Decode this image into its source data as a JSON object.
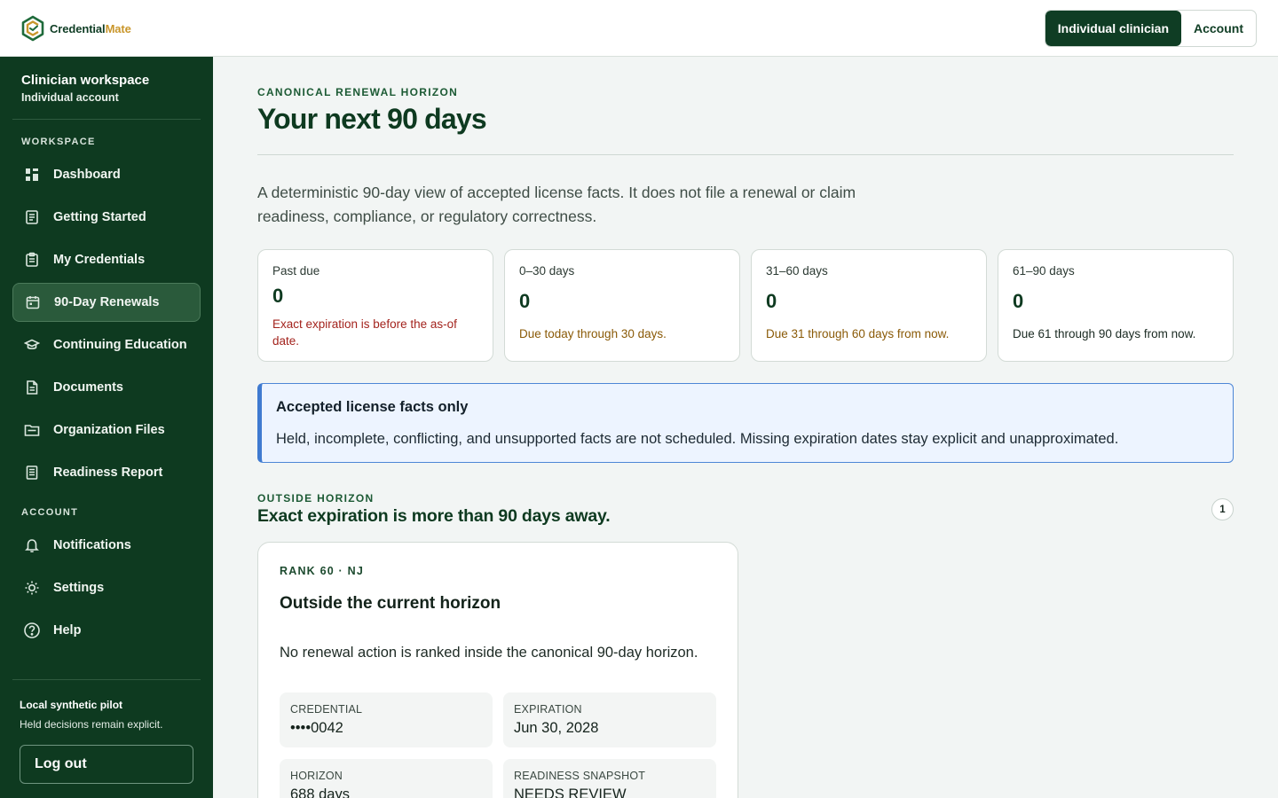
{
  "brand": {
    "name_main": "Credential",
    "name_accent": "Mate"
  },
  "topbar": {
    "individual_label": "Individual clinician",
    "account_label": "Account"
  },
  "sidebar": {
    "workspace_title": "Clinician workspace",
    "workspace_sub": "Individual account",
    "workspace_section": "WORKSPACE",
    "account_section": "ACCOUNT",
    "items": [
      {
        "label": "Dashboard",
        "icon": "dashboard-icon"
      },
      {
        "label": "Getting Started",
        "icon": "checklist-icon"
      },
      {
        "label": "My Credentials",
        "icon": "clipboard-icon"
      },
      {
        "label": "90-Day Renewals",
        "icon": "calendar-icon",
        "active": true
      },
      {
        "label": "Continuing Education",
        "icon": "graduation-cap-icon"
      },
      {
        "label": "Documents",
        "icon": "document-icon"
      },
      {
        "label": "Organization Files",
        "icon": "folder-icon"
      },
      {
        "label": "Readiness Report",
        "icon": "report-icon"
      }
    ],
    "account_items": [
      {
        "label": "Notifications",
        "icon": "bell-icon"
      },
      {
        "label": "Settings",
        "icon": "gear-icon"
      },
      {
        "label": "Help",
        "icon": "help-icon"
      }
    ],
    "pilot_title": "Local synthetic pilot",
    "pilot_sub": "Held decisions remain explicit.",
    "logout_label": "Log out"
  },
  "main": {
    "eyebrow": "CANONICAL RENEWAL HORIZON",
    "title": "Your next 90 days",
    "intro": "A deterministic 90-day view of accepted license facts. It does not file a renewal or claim readiness, compliance, or regulatory correctness.",
    "stats": [
      {
        "label": "Past due",
        "value": "0",
        "note": "Exact expiration is before the as-of date.",
        "tone": "red"
      },
      {
        "label": "0–30 days",
        "value": "0",
        "note": "Due today through 30 days.",
        "tone": "amber"
      },
      {
        "label": "31–60 days",
        "value": "0",
        "note": "Due 31 through 60 days from now.",
        "tone": "amber"
      },
      {
        "label": "61–90 days",
        "value": "0",
        "note": "Due 61 through 90 days from now.",
        "tone": "dark"
      }
    ],
    "callout": {
      "title": "Accepted license facts only",
      "body": "Held, incomplete, conflicting, and unsupported facts are not scheduled. Missing expiration dates stay explicit and unapproximated."
    },
    "outside": {
      "eyebrow": "OUTSIDE HORIZON",
      "title": "Exact expiration is more than 90 days away.",
      "count": "1",
      "card": {
        "eyebrow": "RANK 60 · NJ",
        "title": "Outside the current horizon",
        "body": "No renewal action is ranked inside the canonical 90-day horizon.",
        "facts": [
          {
            "label": "CREDENTIAL",
            "value": "••••0042"
          },
          {
            "label": "EXPIRATION",
            "value": "Jun 30, 2028"
          },
          {
            "label": "HORIZON",
            "value": "688 days"
          },
          {
            "label": "READINESS SNAPSHOT",
            "value": "NEEDS REVIEW"
          }
        ]
      }
    }
  }
}
